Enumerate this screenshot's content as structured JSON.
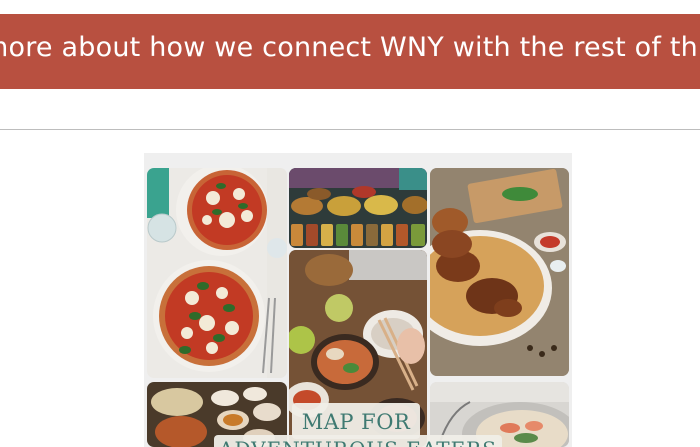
{
  "banner": {
    "text": "more about how we connect WNY with the rest of th",
    "background_color": "#b85040",
    "text_color": "#ffffff"
  },
  "collage": {
    "label_line1": "MAP FOR",
    "label_line2": "ADVENTUROUS EATERS",
    "label_color": "#3f7a72",
    "photos": [
      "pizza-photo",
      "spice-market-photo",
      "roast-chicken-rice-photo",
      "sushi-table-photo",
      "curry-dishes-photo",
      "noodle-bowl-photo"
    ]
  }
}
